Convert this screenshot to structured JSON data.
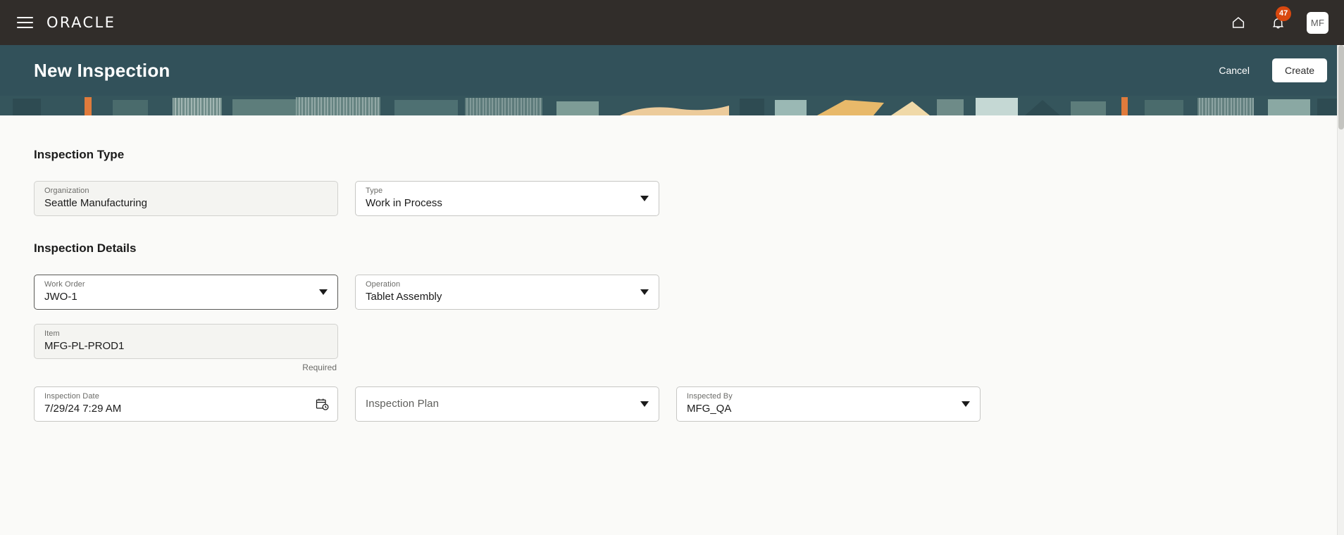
{
  "topbar": {
    "menu_icon": "hamburger-menu-icon",
    "brand": "ORACLE",
    "home_icon": "home-icon",
    "notifications_icon": "bell-icon",
    "notification_count": "47",
    "avatar_initials": "MF"
  },
  "page_header": {
    "title": "New Inspection",
    "cancel_label": "Cancel",
    "create_label": "Create"
  },
  "sections": {
    "inspection_type": {
      "title": "Inspection Type",
      "organization": {
        "label": "Organization",
        "value": "Seattle Manufacturing"
      },
      "type": {
        "label": "Type",
        "value": "Work in Process"
      }
    },
    "inspection_details": {
      "title": "Inspection Details",
      "work_order": {
        "label": "Work Order",
        "value": "JWO-1"
      },
      "operation": {
        "label": "Operation",
        "value": "Tablet Assembly"
      },
      "item": {
        "label": "Item",
        "value": "MFG-PL-PROD1",
        "helper": "Required"
      },
      "inspection_date": {
        "label": "Inspection Date",
        "value": "7/29/24 7:29 AM",
        "icon": "calendar-clock-icon"
      },
      "inspection_plan": {
        "label": "Inspection Plan",
        "value": ""
      },
      "inspected_by": {
        "label": "Inspected By",
        "value": "MFG_QA"
      }
    }
  },
  "colors": {
    "topbar_bg": "#312d2a",
    "header_teal": "#32515a",
    "badge_orange": "#d9480f",
    "content_bg": "#fafaf8",
    "accent_sand": "#e8b96a"
  }
}
